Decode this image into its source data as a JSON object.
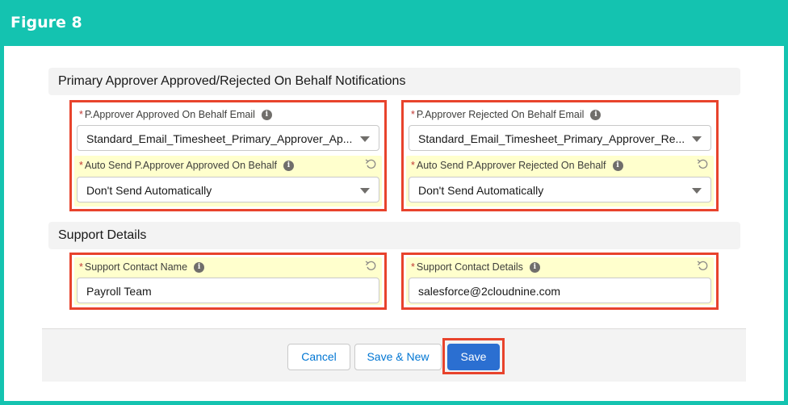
{
  "figure": {
    "title": "Figure 8"
  },
  "sections": {
    "notifications": {
      "title": "Primary Approver Approved/Rejected On Behalf Notifications"
    },
    "support": {
      "title": "Support Details"
    }
  },
  "fields": {
    "approved_email": {
      "required": "*",
      "label": "P.Approver Approved On Behalf Email",
      "value": "Standard_Email_Timesheet_Primary_Approver_Ap..."
    },
    "rejected_email": {
      "required": "*",
      "label": "P.Approver Rejected On Behalf Email",
      "value": "Standard_Email_Timesheet_Primary_Approver_Re..."
    },
    "auto_send_approved": {
      "required": "*",
      "label": "Auto Send P.Approver Approved On Behalf",
      "value": "Don't Send Automatically"
    },
    "auto_send_rejected": {
      "required": "*",
      "label": "Auto Send P.Approver Rejected On Behalf",
      "value": "Don't Send Automatically"
    },
    "support_name": {
      "required": "*",
      "label": "Support Contact Name",
      "value": "Payroll Team"
    },
    "support_details": {
      "required": "*",
      "label": "Support Contact Details",
      "value": "salesforce@2cloudnine.com"
    }
  },
  "icons": {
    "info": "i",
    "info_icon": "info-icon",
    "undo_icon": "undo-icon",
    "dropdown_icon": "chevron-down-icon"
  },
  "buttons": {
    "cancel": "Cancel",
    "save_new": "Save & New",
    "save": "Save"
  },
  "colors": {
    "frame": "#14c3b0",
    "highlight_outline": "#e8432c",
    "edited_field_bg": "#ffffcd",
    "brand_button": "#2b6fd1",
    "link_text": "#0176d3"
  }
}
